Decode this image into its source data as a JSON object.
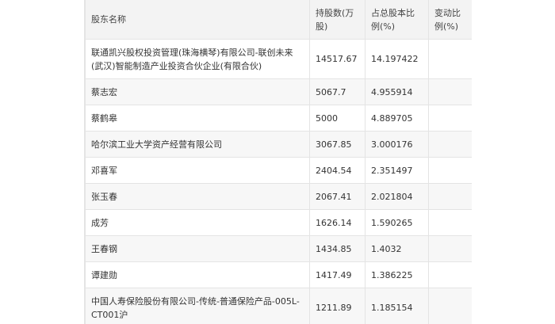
{
  "table": {
    "headers": [
      "股东名称",
      "持股数(万股)",
      "占总股本比例(%)",
      "变动比例(%)"
    ],
    "rows": [
      {
        "name": "联通凯兴股权投资管理(珠海横琴)有限公司-联创未来(武汉)智能制造产业投资合伙企业(有限合伙)",
        "shares": "14517.67",
        "ratio": "14.197422",
        "change": ""
      },
      {
        "name": "蔡志宏",
        "shares": "5067.7",
        "ratio": "4.955914",
        "change": ""
      },
      {
        "name": "蔡鹤皋",
        "shares": "5000",
        "ratio": "4.889705",
        "change": ""
      },
      {
        "name": "哈尔滨工业大学资产经营有限公司",
        "shares": "3067.85",
        "ratio": "3.000176",
        "change": ""
      },
      {
        "name": "邓喜军",
        "shares": "2404.54",
        "ratio": "2.351497",
        "change": ""
      },
      {
        "name": "张玉春",
        "shares": "2067.41",
        "ratio": "2.021804",
        "change": ""
      },
      {
        "name": "成芳",
        "shares": "1626.14",
        "ratio": "1.590265",
        "change": ""
      },
      {
        "name": "王春钢",
        "shares": "1434.85",
        "ratio": "1.4032",
        "change": ""
      },
      {
        "name": "谭建勋",
        "shares": "1417.49",
        "ratio": "1.386225",
        "change": ""
      },
      {
        "name": "中国人寿保险股份有限公司-传统-普通保险产品-005L-CT001沪",
        "shares": "1211.89",
        "ratio": "1.185154",
        "change": ""
      }
    ]
  }
}
